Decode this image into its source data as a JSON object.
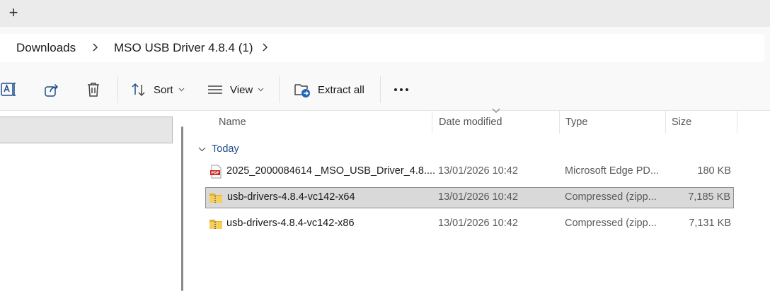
{
  "tabs": {
    "new_tab_label": "+"
  },
  "breadcrumb": {
    "items": [
      "Downloads",
      "MSO USB Driver 4.8.4 (1)"
    ]
  },
  "toolbar": {
    "sort_label": "Sort",
    "view_label": "View",
    "extract_label": "Extract all"
  },
  "columns": {
    "name": "Name",
    "date": "Date modified",
    "type": "Type",
    "size": "Size"
  },
  "groups": [
    {
      "label": "Today",
      "files": [
        {
          "name": "2025_2000084614 _MSO_USB_Driver_4.8....",
          "date": "13/01/2026 10:42",
          "type": "Microsoft Edge PD...",
          "size": "180 KB",
          "icon": "pdf-file-icon",
          "selected": false
        },
        {
          "name": "usb-drivers-4.8.4-vc142-x64",
          "date": "13/01/2026 10:42",
          "type": "Compressed (zipp...",
          "size": "7,185 KB",
          "icon": "zip-folder-icon",
          "selected": true
        },
        {
          "name": "usb-drivers-4.8.4-vc142-x86",
          "date": "13/01/2026 10:42",
          "type": "Compressed (zipp...",
          "size": "7,131 KB",
          "icon": "zip-folder-icon",
          "selected": false
        }
      ]
    }
  ],
  "colors": {
    "accent": "#1e4e8c",
    "selection": "#d9d9d9",
    "toolbar_bg": "#f9f9f9",
    "pdf_red": "#c9241b",
    "zip_yellow": "#f2c94c"
  }
}
